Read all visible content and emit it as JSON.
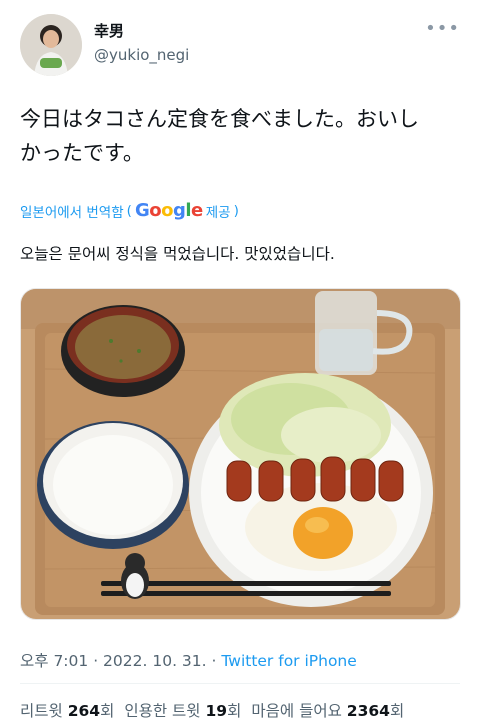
{
  "author": {
    "name": "幸男",
    "handle": "@yukio_negi"
  },
  "more_icon": "more-horizontal-icon",
  "tweet": {
    "line1": "今日はタコさん定食を食べました。おいし",
    "line2": "かったです。"
  },
  "translate": {
    "label": "일본어에서 번역함",
    "provider_suffix": "제공"
  },
  "translation": "오늘은 문어씨 정식을 먹었습니다. 맛있었습니다.",
  "meta": {
    "time": "오후 7:01",
    "sep1": " · ",
    "date": "2022. 10. 31.",
    "sep2": " · ",
    "source": "Twitter for iPhone"
  },
  "stats": {
    "retweets_label": "리트윗",
    "retweets": "264",
    "retweets_unit": "회",
    "quotes_label": "인용한 트윗",
    "quotes": "19",
    "quotes_unit": "회",
    "likes_label": "마음에 들어요",
    "likes": "2364",
    "likes_unit": "회"
  }
}
